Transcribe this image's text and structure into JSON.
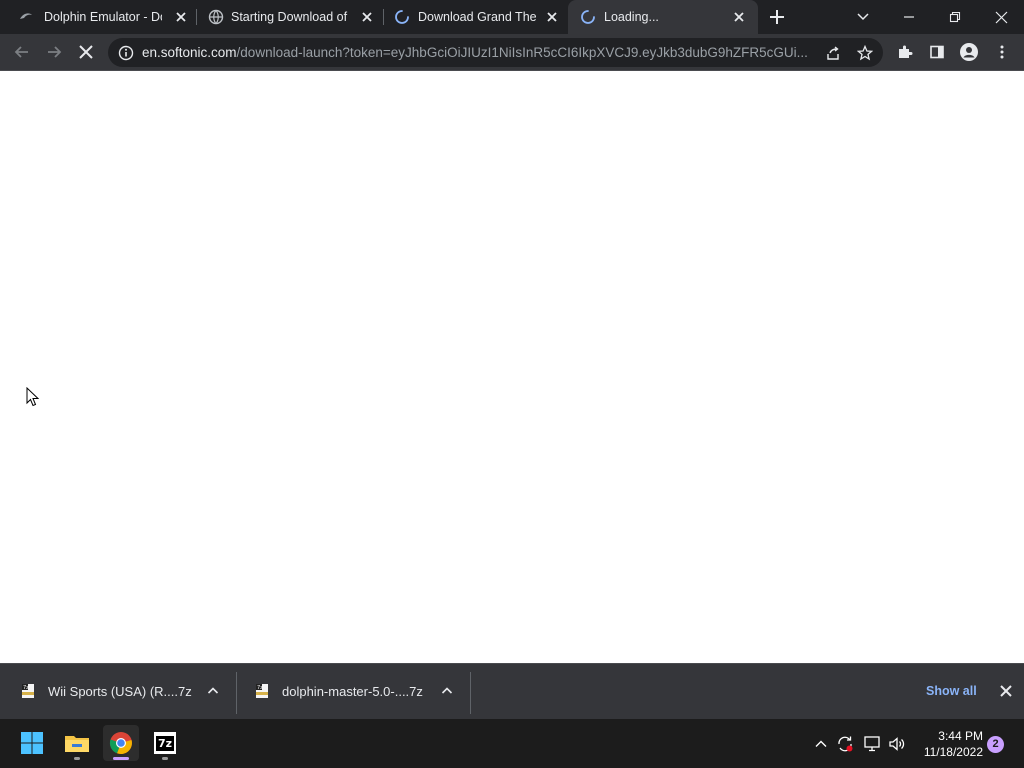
{
  "browser": {
    "tabs": [
      {
        "title": "Dolphin Emulator - Dow",
        "favicon": "dolphin-icon",
        "active": false
      },
      {
        "title": "Starting Download of W",
        "favicon": "globe-icon",
        "active": false
      },
      {
        "title": "Download Grand Theft",
        "favicon": "loading-spinner-icon",
        "active": false
      },
      {
        "title": "Loading...",
        "favicon": "loading-spinner-icon",
        "active": true
      }
    ],
    "address_bar": {
      "host": "en.softonic.com",
      "path": "/download-launch?token=eyJhbGciOiJIUzI1NiIsInR5cCI6IkpXVCJ9.eyJkb3dubG9hZFR5cGUi..."
    }
  },
  "downloads": {
    "items": [
      {
        "name": "Wii Sports (USA) (R....7z",
        "icon": "7z-file-icon"
      },
      {
        "name": "dolphin-master-5.0-....7z",
        "icon": "7z-file-icon"
      }
    ],
    "show_all_label": "Show all"
  },
  "taskbar": {
    "apps": [
      "windows-start-icon",
      "file-explorer-icon",
      "chrome-icon",
      "7zip-icon"
    ],
    "app_7z_label": "7z",
    "clock": {
      "time": "3:44 PM",
      "date": "11/18/2022"
    },
    "notification_count": "2"
  },
  "colors": {
    "tabstrip_bg": "#202124",
    "toolbar_bg": "#35363a",
    "accent_link": "#8ab4f8",
    "taskbar_bg": "#1c1c1c"
  }
}
